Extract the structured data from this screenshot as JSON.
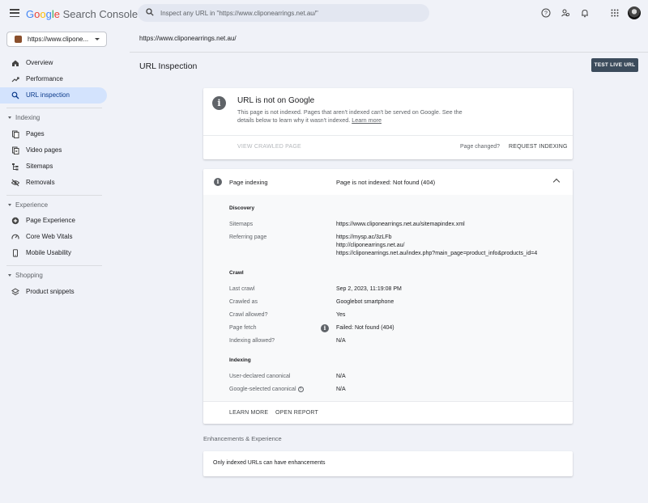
{
  "header": {
    "logo_letters": [
      "G",
      "o",
      "o",
      "g",
      "l",
      "e"
    ],
    "logo_colors": [
      "#4285f4",
      "#ea4335",
      "#fbbc05",
      "#4285f4",
      "#34a853",
      "#ea4335"
    ],
    "product_name": "Search Console",
    "search_placeholder": "Inspect any URL in \"https://www.cliponearrings.net.au/\"",
    "icons": [
      "menu-icon",
      "search-icon",
      "help-icon",
      "people-icon",
      "bell-icon",
      "apps-grid-icon",
      "avatar"
    ]
  },
  "sidebar": {
    "property_label": "https://www.clipone...",
    "items": [
      {
        "label": "Overview",
        "icon": "home-icon"
      },
      {
        "label": "Performance",
        "icon": "trend-icon"
      },
      {
        "label": "URL inspection",
        "icon": "search-icon",
        "active": true
      }
    ],
    "sections": [
      {
        "title": "Indexing",
        "items": [
          {
            "label": "Pages",
            "icon": "pages-icon"
          },
          {
            "label": "Video pages",
            "icon": "video-pages-icon"
          },
          {
            "label": "Sitemaps",
            "icon": "sitemap-icon"
          },
          {
            "label": "Removals",
            "icon": "eye-off-icon"
          }
        ]
      },
      {
        "title": "Experience",
        "items": [
          {
            "label": "Page Experience",
            "icon": "plus-circle-icon"
          },
          {
            "label": "Core Web Vitals",
            "icon": "gauge-icon"
          },
          {
            "label": "Mobile Usability",
            "icon": "phone-icon"
          }
        ]
      },
      {
        "title": "Shopping",
        "items": [
          {
            "label": "Product snippets",
            "icon": "layers-icon"
          }
        ]
      }
    ]
  },
  "main": {
    "breadcrumb_url": "https://www.cliponearrings.net.au/",
    "title": "URL Inspection",
    "test_live_label": "TEST LIVE URL",
    "status": {
      "title": "URL is not on Google",
      "description": "This page is not indexed. Pages that aren't indexed can't be served on Google. See the details below to learn why it wasn't indexed.",
      "learn_more": "Learn more",
      "view_crawled": "VIEW CRAWLED PAGE",
      "page_changed": "Page changed?",
      "request_indexing": "REQUEST INDEXING"
    },
    "page_indexing": {
      "label": "Page indexing",
      "status": "Page is not indexed: Not found (404)",
      "discovery_title": "Discovery",
      "sitemaps_label": "Sitemaps",
      "sitemaps_value": "https://www.cliponearrings.net.au/sitemapindex.xml",
      "referring_label": "Referring page",
      "referring_values": [
        "https://mysp.ac/3zLFb",
        "http://cliponearrings.net.au/",
        "https://cliponearrings.net.au/index.php?main_page=product_info&products_id=4"
      ],
      "crawl_title": "Crawl",
      "last_crawl_label": "Last crawl",
      "last_crawl_value": "Sep 2, 2023, 11:19:08 PM",
      "crawled_as_label": "Crawled as",
      "crawled_as_value": "Googlebot smartphone",
      "crawl_allowed_label": "Crawl allowed?",
      "crawl_allowed_value": "Yes",
      "page_fetch_label": "Page fetch",
      "page_fetch_value": "Failed: Not found (404)",
      "indexing_allowed_label": "Indexing allowed?",
      "indexing_allowed_value": "N/A",
      "indexing_title": "Indexing",
      "user_canonical_label": "User-declared canonical",
      "user_canonical_value": "N/A",
      "google_canonical_label": "Google-selected canonical",
      "google_canonical_value": "N/A",
      "learn_more_btn": "LEARN MORE",
      "open_report_btn": "OPEN REPORT"
    },
    "enhancements": {
      "title": "Enhancements & Experience",
      "message": "Only indexed URLs can have enhancements"
    }
  }
}
